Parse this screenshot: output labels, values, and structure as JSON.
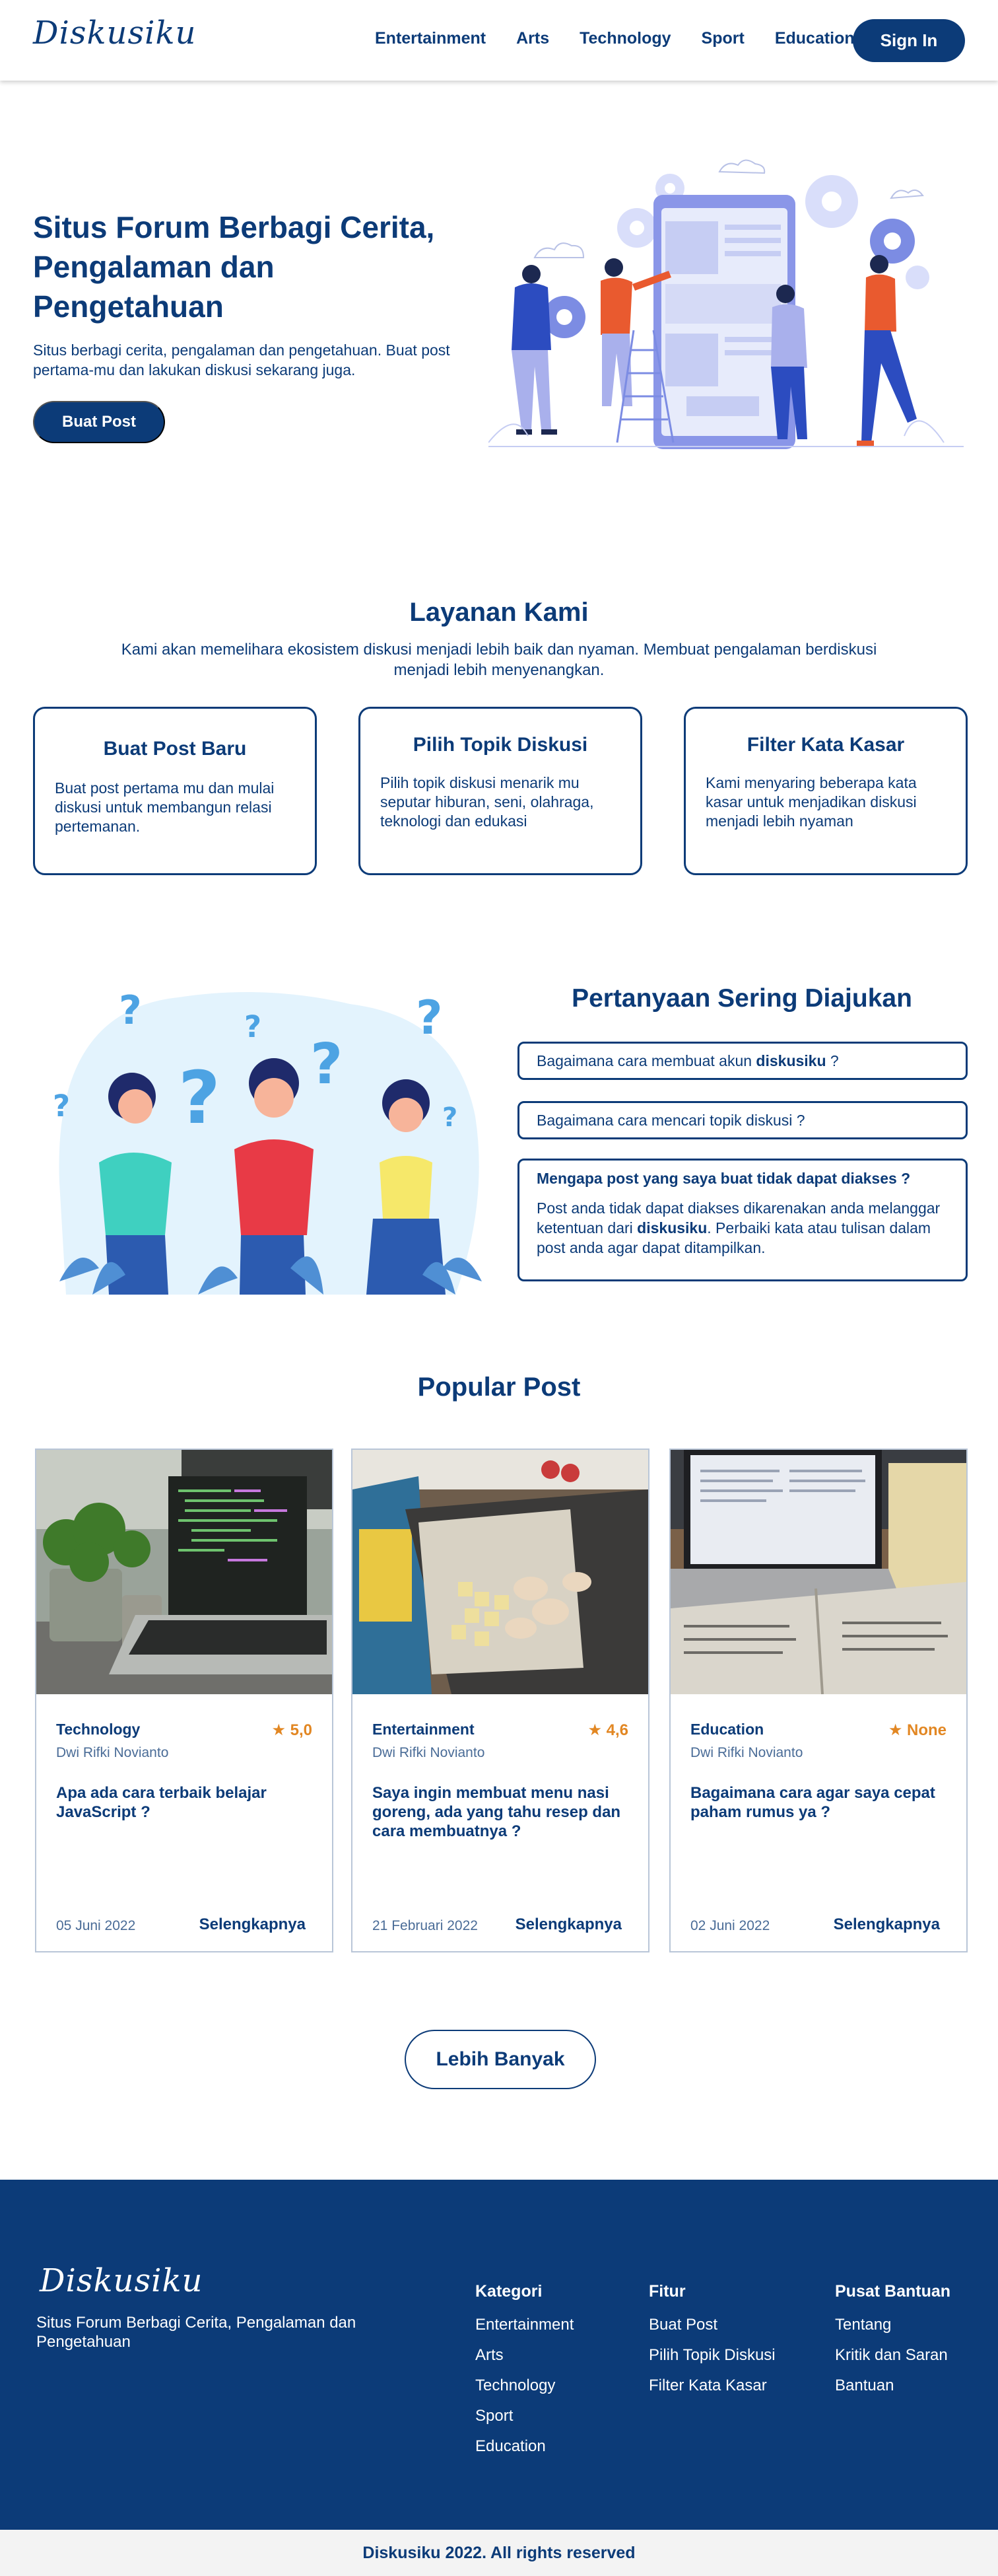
{
  "brand": {
    "name": "Diskusiku"
  },
  "nav": {
    "links": [
      "Entertainment",
      "Arts",
      "Technology",
      "Sport",
      "Education"
    ],
    "signin": "Sign In"
  },
  "hero": {
    "title": "Situs Forum Berbagi Cerita, Pengalaman dan Pengetahuan",
    "desc": "Situs berbagi cerita, pengalaman dan pengetahuan. Buat post pertama-mu dan lakukan diskusi sekarang juga.",
    "button": "Buat Post"
  },
  "services": {
    "title": "Layanan Kami",
    "subtitle": "Kami akan memelihara ekosistem diskusi menjadi lebih baik dan nyaman. Membuat pengalaman berdiskusi menjadi lebih menyenangkan.",
    "cards": [
      {
        "title": "Buat Post Baru",
        "desc": "Buat post pertama mu dan mulai diskusi untuk membangun relasi pertemanan."
      },
      {
        "title": "Pilih Topik Diskusi",
        "desc": "Pilih topik diskusi menarik mu seputar hiburan, seni, olahraga, teknologi dan edukasi"
      },
      {
        "title": "Filter Kata Kasar",
        "desc": "Kami menyaring beberapa kata kasar untuk menjadikan diskusi menjadi lebih nyaman"
      }
    ]
  },
  "faq": {
    "title": "Pertanyaan Sering Diajukan",
    "q1_prefix": "Bagaimana cara membuat akun ",
    "q1_bold": "diskusiku",
    "q1_suffix": " ?",
    "q2": "Bagaimana cara mencari topik diskusi ?",
    "q3": "Mengapa post yang saya buat tidak dapat diakses ?",
    "a3_prefix": "Post anda tidak dapat diakses dikarenakan anda melanggar ketentuan dari ",
    "a3_bold": "diskusiku",
    "a3_suffix": ". Perbaiki kata atau tulisan dalam post anda agar dapat ditampilkan."
  },
  "popular": {
    "title": "Popular  Post",
    "posts": [
      {
        "category": "Technology",
        "rating": "5,0",
        "author": "Dwi Rifki Novianto",
        "title": "Apa ada cara terbaik belajar JavaScript ?",
        "date": "05 Juni 2022",
        "more": "Selengkapnya"
      },
      {
        "category": "Entertainment",
        "rating": "4,6",
        "author": "Dwi Rifki Novianto",
        "title": "Saya ingin membuat menu nasi goreng, ada yang tahu resep dan cara membuatnya  ?",
        "date": "21 Februari 2022",
        "more": "Selengkapnya"
      },
      {
        "category": "Education",
        "rating": "None",
        "author": "Dwi Rifki Novianto",
        "title": "Bagaimana cara agar saya cepat paham rumus ya ?",
        "date": "02 Juni 2022",
        "more": "Selengkapnya"
      }
    ],
    "more_button": "Lebih Banyak"
  },
  "footer": {
    "tagline": "Situs Forum Berbagi Cerita, Pengalaman dan Pengetahuan",
    "columns": [
      {
        "title": "Kategori",
        "links": [
          "Entertainment",
          "Arts",
          "Technology",
          "Sport",
          "Education"
        ]
      },
      {
        "title": "Fitur",
        "links": [
          "Buat Post",
          "Pilih Topik Diskusi",
          "Filter Kata Kasar"
        ]
      },
      {
        "title": "Pusat Bantuan",
        "links": [
          "Tentang",
          "Kritik dan Saran",
          "Bantuan"
        ]
      }
    ],
    "copyright": "Diskusiku 2022. All rights reserved"
  },
  "colors": {
    "primary": "#0c3b78",
    "accent": "#e28723",
    "light": "#f3f3f3"
  }
}
